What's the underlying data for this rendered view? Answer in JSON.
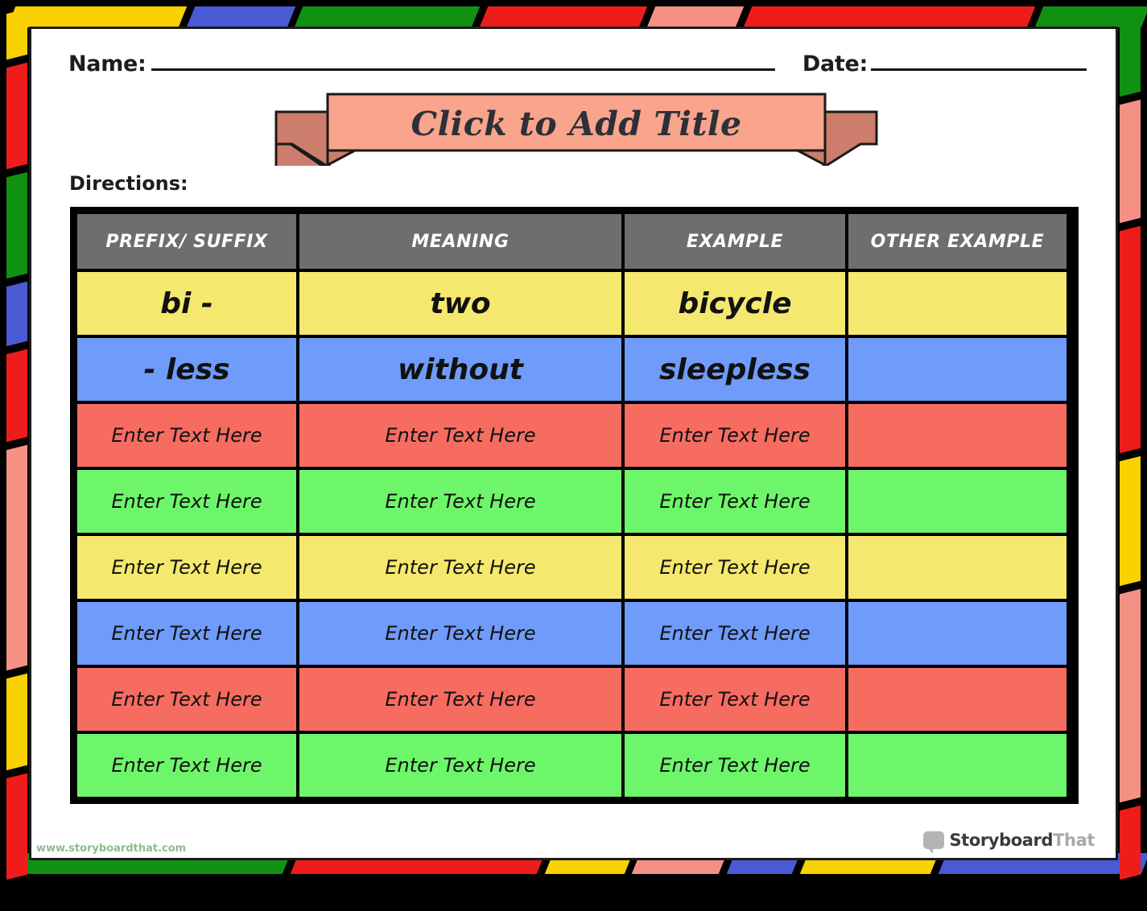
{
  "worksheet": {
    "name_label": "Name:",
    "date_label": "Date:",
    "title": "Click to Add Title",
    "directions_label": "Directions:"
  },
  "table": {
    "headers": [
      "PREFIX/ SUFFIX",
      "MEANING",
      "EXAMPLE",
      "OTHER EXAMPLE"
    ],
    "placeholder": "Enter Text Here",
    "rows": [
      {
        "color": "yellow",
        "cells": [
          "bi -",
          "two",
          "bicycle",
          ""
        ],
        "filled": true
      },
      {
        "color": "blue",
        "cells": [
          "- less",
          "without",
          "sleepless",
          ""
        ],
        "filled": true
      },
      {
        "color": "red",
        "cells": [
          "Enter Text Here",
          "Enter Text Here",
          "Enter Text Here",
          ""
        ],
        "filled": false
      },
      {
        "color": "green",
        "cells": [
          "Enter Text Here",
          "Enter Text Here",
          "Enter Text Here",
          ""
        ],
        "filled": false
      },
      {
        "color": "yellow",
        "cells": [
          "Enter Text Here",
          "Enter Text Here",
          "Enter Text Here",
          ""
        ],
        "filled": false
      },
      {
        "color": "blue",
        "cells": [
          "Enter Text Here",
          "Enter Text Here",
          "Enter Text Here",
          ""
        ],
        "filled": false
      },
      {
        "color": "red",
        "cells": [
          "Enter Text Here",
          "Enter Text Here",
          "Enter Text Here",
          ""
        ],
        "filled": false
      },
      {
        "color": "green",
        "cells": [
          "Enter Text Here",
          "Enter Text Here",
          "Enter Text Here",
          ""
        ],
        "filled": false
      }
    ]
  },
  "branding": {
    "watermark": "www.storyboardthat.com",
    "logo_text_1": "Storyboard",
    "logo_text_2": "That"
  },
  "colors": {
    "yellow": "#f5e86e",
    "blue": "#6f9bfa",
    "red": "#f66c61",
    "green": "#6ef66b",
    "header_gray": "#6e6e6e",
    "ribbon_fill": "#f9a48c",
    "ribbon_tail": "#cc7d6b",
    "border_black": "#000000",
    "frame_yellow": "#f7d200",
    "frame_red": "#ef1c1c",
    "frame_green": "#119111",
    "frame_blue": "#4a59d4",
    "frame_salmon": "#f49084"
  },
  "frame_dashes": {
    "top": [
      "yellow",
      "blue",
      "green",
      "red",
      "salmon",
      "red",
      "green"
    ],
    "left": [
      "yellow",
      "red",
      "green",
      "blue",
      "red",
      "salmon",
      "yellow",
      "red"
    ],
    "right": [
      "green",
      "salmon",
      "red",
      "yellow",
      "salmon",
      "red"
    ],
    "bottom": [
      "green",
      "red",
      "yellow",
      "salmon",
      "blue",
      "yellow",
      "blue"
    ]
  }
}
